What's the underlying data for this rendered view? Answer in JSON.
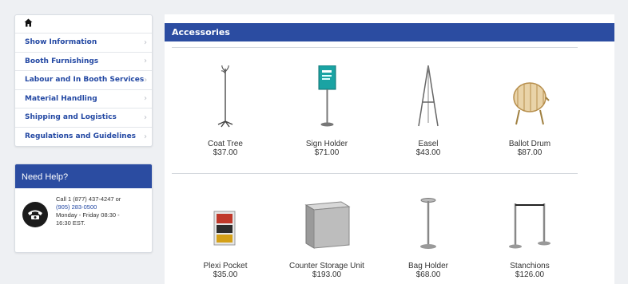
{
  "nav": {
    "items": [
      {
        "label": "Show Information"
      },
      {
        "label": "Booth Furnishings"
      },
      {
        "label": "Labour and In Booth Services"
      },
      {
        "label": "Material Handling"
      },
      {
        "label": "Shipping and Logistics"
      },
      {
        "label": "Regulations and Guidelines"
      }
    ],
    "chevron": "›"
  },
  "help": {
    "title": "Need Help?",
    "line1": "Call 1 (877) 437-4247 or",
    "line2": "(905) 283-0500",
    "line3": "Monday - Friday 08:30 -",
    "line4": "16:30 EST."
  },
  "main": {
    "title": "Accessories",
    "products": [
      {
        "name": "Coat Tree",
        "price": "$37.00",
        "icon": "coat-tree-image"
      },
      {
        "name": "Sign Holder",
        "price": "$71.00",
        "icon": "sign-holder-image"
      },
      {
        "name": "Easel",
        "price": "$43.00",
        "icon": "easel-image"
      },
      {
        "name": "Ballot Drum",
        "price": "$87.00",
        "icon": "ballot-drum-image"
      },
      {
        "name": "Plexi Pocket",
        "price": "$35.00",
        "icon": "plexi-pocket-image"
      },
      {
        "name": "Counter Storage Unit",
        "price": "$193.00",
        "icon": "counter-storage-image"
      },
      {
        "name": "Bag Holder",
        "price": "$68.00",
        "icon": "bag-holder-image"
      },
      {
        "name": "Stanchions",
        "price": "$126.00",
        "icon": "stanchions-image"
      }
    ]
  },
  "colors": {
    "accent": "#2b4ca1",
    "link": "#2348a3",
    "sign": "#1aa3a3"
  }
}
